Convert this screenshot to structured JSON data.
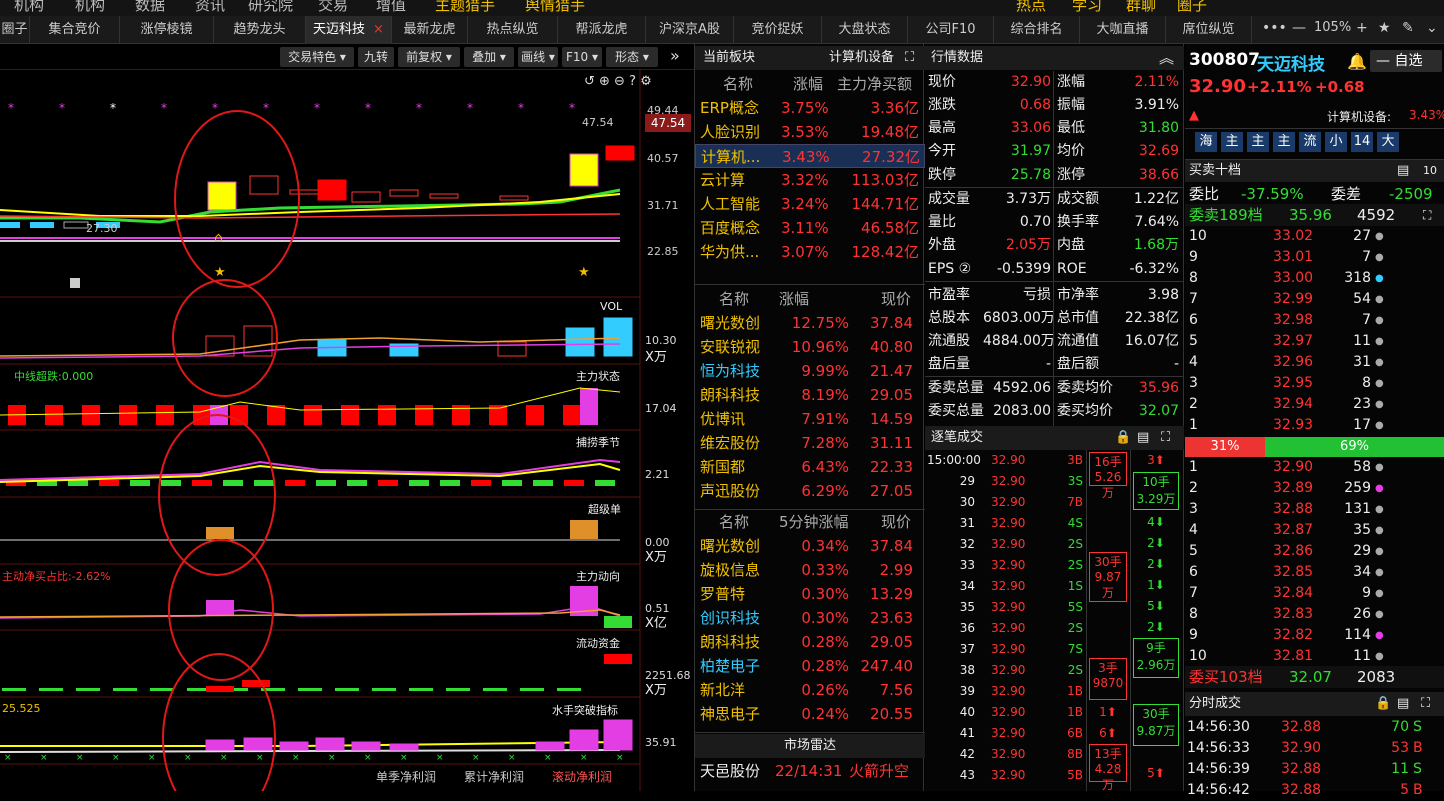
{
  "menubar": {
    "items": [
      "机构",
      "机构",
      "数据",
      "资讯",
      "研究院",
      "交易",
      "增值",
      "主题猎手",
      "舆情猎手"
    ],
    "right": [
      "热点",
      "学习",
      "群聊",
      "圈子"
    ]
  },
  "tabs": {
    "items": [
      "圈子",
      "集合竞价",
      "涨停棱镜",
      "趋势龙头",
      "天迈科技",
      "最新龙虎",
      "热点纵览",
      "帮派龙虎",
      "沪深京A股",
      "竞价捉妖",
      "大盘状态",
      "公司F10",
      "综合排名",
      "大咖直播",
      "席位纵览"
    ],
    "active": "天迈科技",
    "close": "×",
    "zoom": "105%"
  },
  "chart_toolbar": [
    "交易特色 ▾",
    "九转",
    "前复权 ▾",
    "叠加 ▾",
    "画线 ▾",
    "F10 ▾",
    "形态 ▾"
  ],
  "main_chart": {
    "price_labels": [
      "47.54",
      "40.57",
      "31.71",
      "22.85"
    ],
    "current_price": "47.54",
    "top_label": "47.54",
    "low_label": "27.30",
    "top_tick": "49.44"
  },
  "indicators": {
    "vol": {
      "title": "VOL",
      "value": "10.30",
      "unit": "X万"
    },
    "zx": {
      "title": "中线超跌:0.000"
    },
    "zlzt": {
      "title": "主力状态",
      "value": "17.04"
    },
    "blij": {
      "title": "捕捞季节",
      "value": "2.21"
    },
    "cjd": {
      "title": "超级单",
      "value": "0.00",
      "unit": "X万"
    },
    "zldx": {
      "title": "主力动向",
      "left": "主动净买占比:-2.62%",
      "value": "0.51",
      "unit": "X亿"
    },
    "ldzj": {
      "title": "流动资金",
      "value": "2251.68",
      "unit": "X万"
    },
    "sstp": {
      "title": "水手突破指标",
      "left": "25.525",
      "value": "35.91"
    }
  },
  "bottom_tabs": [
    "单季净利润",
    "累计净利润",
    "滚动净利润"
  ],
  "sector": {
    "title": "当前板块",
    "current": "计算机设备",
    "headers": [
      "名称",
      "涨幅",
      "主力净买额"
    ],
    "rows": [
      [
        "ERP概念",
        "3.75%",
        "3.36亿"
      ],
      [
        "人脸识别",
        "3.53%",
        "19.48亿"
      ],
      [
        "计算机...",
        "3.43%",
        "27.32亿"
      ],
      [
        "云计算",
        "3.32%",
        "113.03亿"
      ],
      [
        "人工智能",
        "3.24%",
        "144.71亿"
      ],
      [
        "百度概念",
        "3.11%",
        "46.58亿"
      ],
      [
        "华为供...",
        "3.07%",
        "128.42亿"
      ]
    ]
  },
  "stocks1": {
    "headers": [
      "名称",
      "涨幅",
      "现价"
    ],
    "rows": [
      [
        "曙光数创",
        "12.75%",
        "37.84"
      ],
      [
        "安联锐视",
        "10.96%",
        "40.80"
      ],
      [
        "恒为科技",
        "9.99%",
        "21.47"
      ],
      [
        "朗科科技",
        "8.19%",
        "29.05"
      ],
      [
        "优博讯",
        "7.91%",
        "14.59"
      ],
      [
        "维宏股份",
        "7.28%",
        "31.11"
      ],
      [
        "新国都",
        "6.43%",
        "22.33"
      ],
      [
        "声迅股份",
        "6.29%",
        "27.05"
      ]
    ]
  },
  "stocks2": {
    "headers": [
      "名称",
      "5分钟涨幅",
      "现价"
    ],
    "rows": [
      [
        "曙光数创",
        "0.34%",
        "37.84"
      ],
      [
        "旋极信息",
        "0.33%",
        "2.99"
      ],
      [
        "罗普特",
        "0.30%",
        "13.29"
      ],
      [
        "创识科技",
        "0.30%",
        "23.63"
      ],
      [
        "朗科科技",
        "0.28%",
        "29.05"
      ],
      [
        "柏楚电子",
        "0.28%",
        "247.40"
      ],
      [
        "新北洋",
        "0.26%",
        "7.56"
      ],
      [
        "神思电子",
        "0.24%",
        "20.55"
      ]
    ]
  },
  "radar": {
    "title": "市场雷达",
    "rows": [
      [
        "天邑股份",
        "22/14:31",
        "火箭升空"
      ]
    ]
  },
  "quote": {
    "title": "行情数据",
    "rows": [
      [
        "现价",
        "32.90",
        "涨幅",
        "2.11%"
      ],
      [
        "涨跌",
        "0.68",
        "振幅",
        "3.91%"
      ],
      [
        "最高",
        "33.06",
        "最低",
        "31.80"
      ],
      [
        "今开",
        "31.97",
        "均价",
        "32.69"
      ],
      [
        "跌停",
        "25.78",
        "涨停",
        "38.66"
      ],
      [
        "成交量",
        "3.73万",
        "成交额",
        "1.22亿"
      ],
      [
        "量比",
        "0.70",
        "换手率",
        "7.64%"
      ],
      [
        "外盘",
        "2.05万",
        "内盘",
        "1.68万"
      ],
      [
        "EPS ②",
        "-0.5399",
        "ROE",
        "-6.32%"
      ],
      [
        "市盈率",
        "亏损",
        "市净率",
        "3.98"
      ],
      [
        "总股本",
        "6803.00万",
        "总市值",
        "22.38亿"
      ],
      [
        "流通股",
        "4884.00万",
        "流通值",
        "16.07亿"
      ],
      [
        "盘后量",
        "-",
        "盘后额",
        "-"
      ],
      [
        "委卖总量",
        "4592.06",
        "委卖均价",
        "35.96"
      ],
      [
        "委买总量",
        "2083.00",
        "委买均价",
        "32.07"
      ]
    ]
  },
  "ticks": {
    "title": "逐笔成交",
    "rows": [
      [
        "15:00:00",
        "32.90",
        "3B"
      ],
      [
        "29",
        "32.90",
        "3S"
      ],
      [
        "30",
        "32.90",
        "7B"
      ],
      [
        "31",
        "32.90",
        "4S"
      ],
      [
        "32",
        "32.90",
        "2S"
      ],
      [
        "33",
        "32.90",
        "2S"
      ],
      [
        "34",
        "32.90",
        "1S"
      ],
      [
        "35",
        "32.90",
        "5S"
      ],
      [
        "36",
        "32.90",
        "2S"
      ],
      [
        "37",
        "32.90",
        "7S"
      ],
      [
        "38",
        "32.90",
        "2S"
      ],
      [
        "39",
        "32.90",
        "1B"
      ],
      [
        "40",
        "32.90",
        "1B"
      ],
      [
        "41",
        "32.90",
        "6B"
      ],
      [
        "42",
        "32.90",
        "8B"
      ],
      [
        "43",
        "32.90",
        "5B"
      ]
    ],
    "big_sell": [
      [
        "16手",
        "5.26万"
      ],
      [
        "30手",
        "9.87万"
      ],
      [
        "3手",
        "9870"
      ],
      [
        "1⬆",
        ""
      ],
      [
        "6⬆",
        ""
      ],
      [
        "13手",
        "4.28万"
      ]
    ],
    "big_buy": [
      [
        "3⬆",
        ""
      ],
      [
        "10手",
        "3.29万"
      ],
      [
        "4⬇",
        ""
      ],
      [
        "2⬇",
        ""
      ],
      [
        "2⬇",
        ""
      ],
      [
        "1⬇",
        ""
      ],
      [
        "5⬇",
        ""
      ],
      [
        "2⬇",
        ""
      ],
      [
        "9手",
        "2.96万"
      ],
      [
        "30手",
        "9.87万"
      ],
      [
        "5⬆",
        ""
      ]
    ]
  },
  "stock": {
    "code": "300807",
    "name": "天迈科技",
    "price": "32.90",
    "change_pct": "+2.11%",
    "change": "+0.68",
    "industry": "计算机设备:",
    "industry_pct": "3.43%",
    "watch": "自选",
    "badges": [
      "海",
      "主",
      "主",
      "主",
      "流",
      "小",
      "14",
      "大"
    ]
  },
  "orderbook": {
    "title": "买卖十档",
    "ratio_label": "委比",
    "ratio": "-37.59%",
    "diff_label": "委差",
    "diff": "-2509",
    "sell_summary": [
      "委卖189档",
      "35.96",
      "4592"
    ],
    "sells": [
      [
        "10",
        "33.02",
        "27"
      ],
      [
        "9",
        "33.01",
        "7"
      ],
      [
        "8",
        "33.00",
        "318"
      ],
      [
        "7",
        "32.99",
        "54"
      ],
      [
        "6",
        "32.98",
        "7"
      ],
      [
        "5",
        "32.97",
        "11"
      ],
      [
        "4",
        "32.96",
        "31"
      ],
      [
        "3",
        "32.95",
        "8"
      ],
      [
        "2",
        "32.94",
        "23"
      ],
      [
        "1",
        "32.93",
        "17"
      ]
    ],
    "bar": {
      "sell_pct": "31%",
      "buy_pct": "69%",
      "sell_frac": 0.31
    },
    "buys": [
      [
        "1",
        "32.90",
        "58"
      ],
      [
        "2",
        "32.89",
        "259"
      ],
      [
        "3",
        "32.88",
        "131"
      ],
      [
        "4",
        "32.87",
        "35"
      ],
      [
        "5",
        "32.86",
        "29"
      ],
      [
        "6",
        "32.85",
        "34"
      ],
      [
        "7",
        "32.84",
        "9"
      ],
      [
        "8",
        "32.83",
        "26"
      ],
      [
        "9",
        "32.82",
        "114"
      ],
      [
        "10",
        "32.81",
        "11"
      ]
    ],
    "buy_summary": [
      "委买103档",
      "32.07",
      "2083"
    ]
  },
  "timesales": {
    "title": "分时成交",
    "rows": [
      [
        "14:56:30",
        "32.88",
        "70",
        "S"
      ],
      [
        "14:56:33",
        "32.90",
        "53",
        "B"
      ],
      [
        "14:56:39",
        "32.88",
        "11",
        "S"
      ],
      [
        "14:56:42",
        "32.88",
        "5",
        "B"
      ]
    ]
  },
  "colors": {
    "up": "#ff3333",
    "down": "#33dd33",
    "accent": "#f0c000"
  }
}
